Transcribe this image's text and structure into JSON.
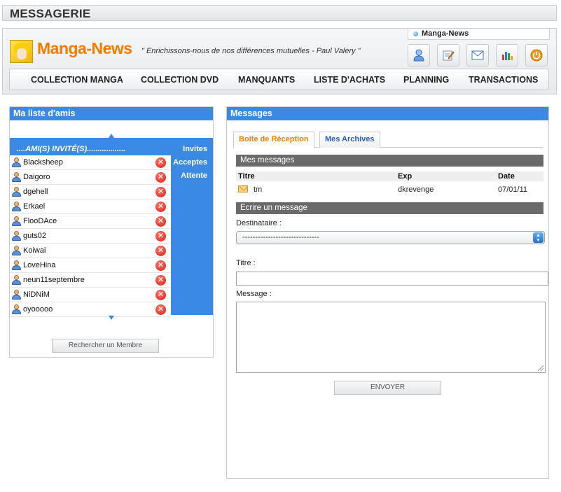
{
  "page": {
    "title": "MESSAGERIE"
  },
  "header": {
    "site_name": "Manga-News",
    "logo_text": "Manga-News",
    "quote": "\" Enrichissons-nous de nos différences mutuelles - Paul Valery \"",
    "icons": [
      "user-icon",
      "edit-icon",
      "mail-icon",
      "bar-chart-icon",
      "power-icon"
    ],
    "nav": [
      "COLLECTION MANGA",
      "COLLECTION DVD",
      "MANQUANTS",
      "LISTE D'ACHATS",
      "PLANNING",
      "TRANSACTIONS"
    ]
  },
  "friends": {
    "title": "Ma liste d'amis",
    "invite_header": "....AMI(S) INVITÉ(S)..................",
    "side_tabs": [
      "Invites",
      "Acceptes",
      "Attente"
    ],
    "list": [
      "Blacksheep",
      "Daigoro",
      "dgehell",
      "Erkael",
      "FlooDAce",
      "guts02",
      "Koiwai",
      "LoveHina",
      "neun11septembre",
      "NiDNiM",
      "oyooooo"
    ],
    "search_button": "Rechercher un Membre"
  },
  "messages": {
    "title": "Messages",
    "tabs": [
      "Boite de Réception",
      "Mes Archives"
    ],
    "inbox_header": "Mes messages",
    "columns": [
      "Titre",
      "Exp",
      "Date"
    ],
    "rows": [
      {
        "title": "tm",
        "from": "dkrevenge",
        "date": "07/01/11"
      }
    ],
    "compose_header": "Ecrire un message",
    "recipient_label": "Destinataire :",
    "recipient_value": "------------------------------",
    "title_label": "Titre :",
    "message_label": "Message :",
    "send_button": "ENVOYER"
  },
  "colors": {
    "accent_blue": "#3a8ae3",
    "brand_orange": "#f07d00",
    "section_gray": "#6a6a6a"
  }
}
